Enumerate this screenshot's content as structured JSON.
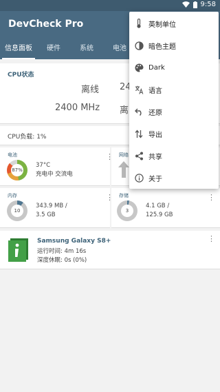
{
  "status_bar": {
    "time": "9:58"
  },
  "app": {
    "title": "DevCheck Pro"
  },
  "tabs": [
    {
      "label": "信息面板"
    },
    {
      "label": "硬件"
    },
    {
      "label": "系统"
    },
    {
      "label": "电池"
    }
  ],
  "cpu": {
    "title": "CPU状态",
    "cells": [
      {
        "value": "离线"
      },
      {
        "value": "24"
      },
      {
        "value": "2400 MHz"
      },
      {
        "value": "离"
      }
    ]
  },
  "cpu_load": {
    "text": "CPU负载: 1%"
  },
  "battery": {
    "title": "电池",
    "level": "87%",
    "level_fraction": 0.87,
    "temp": "37°C",
    "status": "充电中 交流电"
  },
  "network": {
    "title": "网络"
  },
  "memory": {
    "title": "内存",
    "percent": "10",
    "percent_fraction": 0.1,
    "used": "343.9 MB /",
    "total": "3.5 GB"
  },
  "storage": {
    "title": "存储",
    "percent": "3",
    "percent_fraction": 0.03,
    "used": "4.1 GB /",
    "total": "125.9 GB"
  },
  "device": {
    "name": "Samsung Galaxy S8+",
    "uptime": "运行时间: 4m 16s",
    "deep_sleep": "深度休眠: 0s (0%)"
  },
  "menu": {
    "items": [
      {
        "label": "英制单位",
        "icon": "thermometer-icon"
      },
      {
        "label": "暗色主题",
        "icon": "contrast-icon"
      },
      {
        "label": "Dark",
        "icon": "palette-icon"
      },
      {
        "label": "语言",
        "icon": "translate-icon"
      },
      {
        "label": "还原",
        "icon": "undo-icon"
      },
      {
        "label": "导出",
        "icon": "import-export-icon"
      },
      {
        "label": "共享",
        "icon": "share-icon"
      },
      {
        "label": "关于",
        "icon": "info-icon"
      }
    ]
  },
  "colors": {
    "primary": "#496a82",
    "status_bar": "#3e5b6f",
    "accent": "#3d6278",
    "battery_ring": "#7cb342"
  }
}
